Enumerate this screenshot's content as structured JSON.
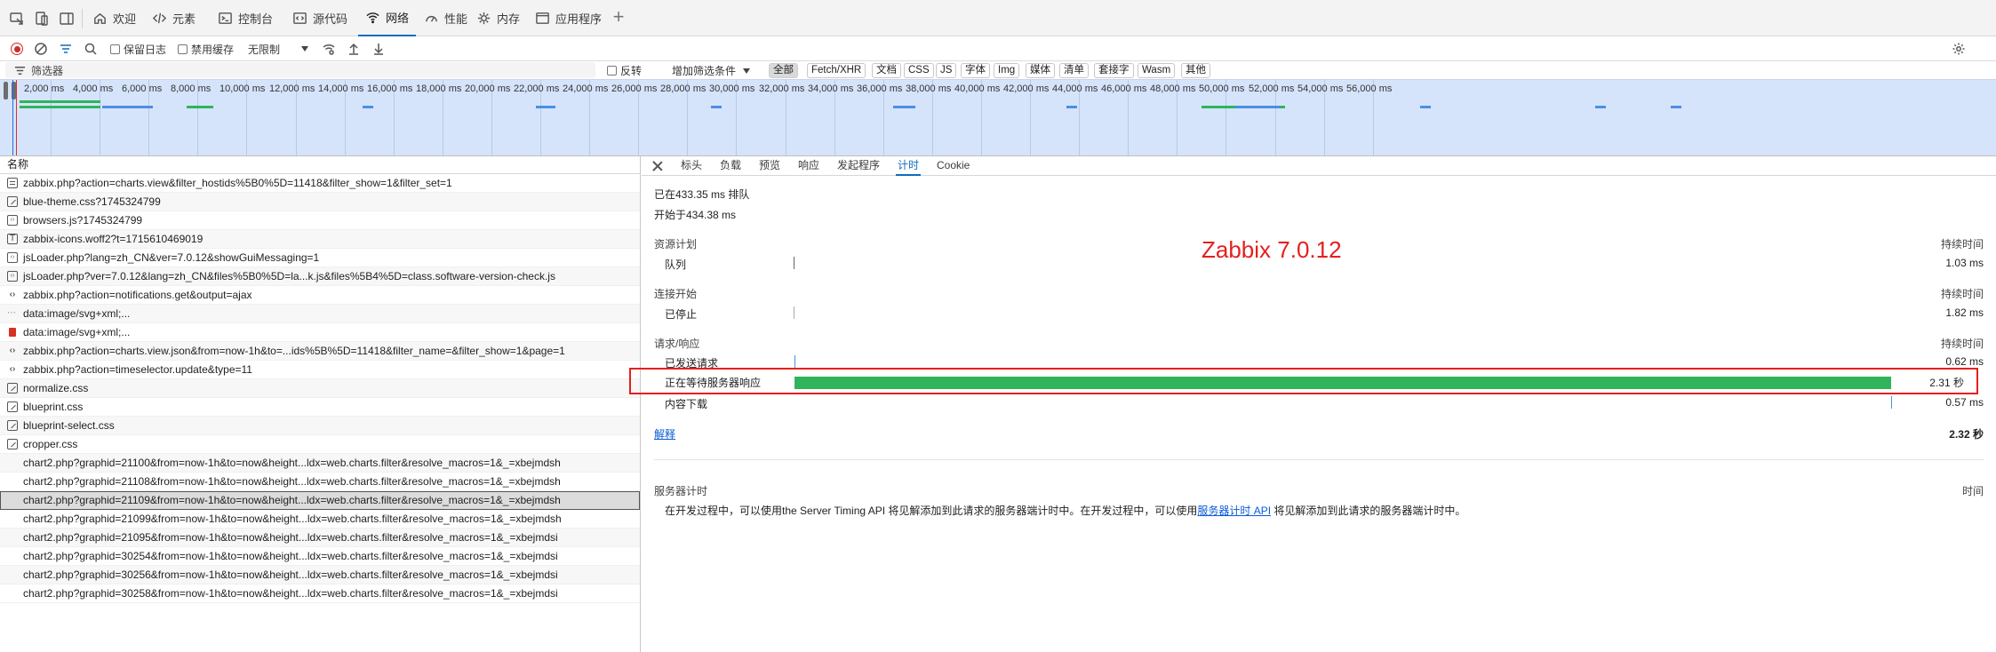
{
  "tabbar": {
    "tabs": [
      {
        "label": "欢迎",
        "icon": "home-icon"
      },
      {
        "label": "元素",
        "icon": "code-icon"
      },
      {
        "label": "控制台",
        "icon": "console-icon"
      },
      {
        "label": "源代码",
        "icon": "sources-icon"
      },
      {
        "label": "网络",
        "icon": "wifi-icon"
      },
      {
        "label": "性能",
        "icon": "performance-icon"
      },
      {
        "label": "内存",
        "icon": "memory-icon"
      },
      {
        "label": "应用程序",
        "icon": "application-icon"
      }
    ],
    "active_tab": "网络"
  },
  "toolbar": {
    "preserve_log": "保留日志",
    "disable_cache": "禁用缓存",
    "throttling": "无限制"
  },
  "filter": {
    "placeholder": "筛选器",
    "invert": "反转",
    "more_filters": "增加筛选条件",
    "types": [
      "全部",
      "Fetch/XHR",
      "文档",
      "CSS",
      "JS",
      "字体",
      "Img",
      "媒体",
      "清单",
      "套接字",
      "Wasm",
      "其他"
    ],
    "active_type": "全部"
  },
  "overview": {
    "ticks": [
      "2,000 ms",
      "4,000 ms",
      "6,000 ms",
      "8,000 ms",
      "10,000 ms",
      "12,000 ms",
      "14,000 ms",
      "16,000 ms",
      "18,000 ms",
      "20,000 ms",
      "22,000 ms",
      "24,000 ms",
      "26,000 ms",
      "28,000 ms",
      "30,000 ms",
      "32,000 ms",
      "34,000 ms",
      "36,000 ms",
      "38,000 ms",
      "40,000 ms",
      "42,000 ms",
      "44,000 ms",
      "46,000 ms",
      "48,000 ms",
      "50,000 ms",
      "52,000 ms",
      "54,000 ms",
      "56,000 ms"
    ],
    "colors": {
      "waiting": "#2fb45c",
      "receiving": "#4a90e2",
      "background": "#d5e4fb"
    }
  },
  "requests": {
    "header": "名称",
    "rows": [
      {
        "name": "zabbix.php?action=charts.view&filter_hostids%5B0%5D=11418&filter_show=1&filter_set=1",
        "icon": "document-icon"
      },
      {
        "name": "blue-theme.css?1745324799",
        "icon": "stylesheet-icon"
      },
      {
        "name": "browsers.js?1745324799",
        "icon": "script-icon"
      },
      {
        "name": "zabbix-icons.woff2?t=1715610469019",
        "icon": "font-icon"
      },
      {
        "name": "jsLoader.php?lang=zh_CN&ver=7.0.12&showGuiMessaging=1",
        "icon": "script-icon"
      },
      {
        "name": "jsLoader.php?ver=7.0.12&lang=zh_CN&files%5B0%5D=la...k.js&files%5B4%5D=class.software-version-check.js",
        "icon": "script-icon"
      },
      {
        "name": "zabbix.php?action=notifications.get&output=ajax",
        "icon": "fetch-icon"
      },
      {
        "name": "data:image/svg+xml;...",
        "icon": "svg-data-icon"
      },
      {
        "name": "data:image/svg+xml;...",
        "icon": "image-icon"
      },
      {
        "name": "zabbix.php?action=charts.view.json&from=now-1h&to=...ids%5B%5D=11418&filter_name=&filter_show=1&page=1",
        "icon": "fetch-icon"
      },
      {
        "name": "zabbix.php?action=timeselector.update&type=11",
        "icon": "fetch-icon"
      },
      {
        "name": "normalize.css",
        "icon": "stylesheet-icon"
      },
      {
        "name": "blueprint.css",
        "icon": "stylesheet-icon"
      },
      {
        "name": "blueprint-select.css",
        "icon": "stylesheet-icon"
      },
      {
        "name": "cropper.css",
        "icon": "stylesheet-icon"
      },
      {
        "name": "chart2.php?graphid=21100&from=now-1h&to=now&height...ldx=web.charts.filter&resolve_macros=1&_=xbejmdsh",
        "icon": ""
      },
      {
        "name": "chart2.php?graphid=21108&from=now-1h&to=now&height...ldx=web.charts.filter&resolve_macros=1&_=xbejmdsh",
        "icon": ""
      },
      {
        "name": "chart2.php?graphid=21109&from=now-1h&to=now&height...ldx=web.charts.filter&resolve_macros=1&_=xbejmdsh",
        "icon": ""
      },
      {
        "name": "chart2.php?graphid=21099&from=now-1h&to=now&height...ldx=web.charts.filter&resolve_macros=1&_=xbejmdsh",
        "icon": ""
      },
      {
        "name": "chart2.php?graphid=21095&from=now-1h&to=now&height...ldx=web.charts.filter&resolve_macros=1&_=xbejmdsi",
        "icon": ""
      },
      {
        "name": "chart2.php?graphid=30254&from=now-1h&to=now&height...ldx=web.charts.filter&resolve_macros=1&_=xbejmdsi",
        "icon": ""
      },
      {
        "name": "chart2.php?graphid=30256&from=now-1h&to=now&height...ldx=web.charts.filter&resolve_macros=1&_=xbejmdsi",
        "icon": ""
      },
      {
        "name": "chart2.php?graphid=30258&from=now-1h&to=now&height...ldx=web.charts.filter&resolve_macros=1&_=xbejmdsi",
        "icon": ""
      }
    ],
    "selected_index": 17
  },
  "detail": {
    "tabs": [
      "标头",
      "负载",
      "预览",
      "响应",
      "发起程序",
      "计时",
      "Cookie"
    ],
    "active_tab": "计时",
    "queued_at": "已在433.35 ms 排队",
    "started_at": "开始于434.38 ms",
    "duration_header": "持续时间",
    "sections": {
      "resource_scheduling": {
        "title": "资源计划",
        "label": "队列",
        "duration": "1.03 ms"
      },
      "connection_start": {
        "title": "连接开始",
        "label": "已停止",
        "duration": "1.82 ms"
      },
      "request_response": {
        "title": "请求/响应",
        "sent": {
          "label": "已发送请求",
          "duration": "0.62 ms"
        },
        "waiting": {
          "label": "正在等待服务器响应",
          "duration": "2.31 秒"
        },
        "download": {
          "label": "内容下载",
          "duration": "0.57 ms"
        }
      }
    },
    "explanation_link": "解释",
    "total": "2.32 秒",
    "server_timing": {
      "title": "服务器计时",
      "time_header": "时间",
      "text_prefix": "在开发过程中，可以使用the Server Timing API 将见解添加到此请求的服务器端计时中。在开发过程中，可以使用",
      "link": "服务器计时 API",
      "text_suffix": " 将见解添加到此请求的服务器端计时中。"
    },
    "annotation": "Zabbix 7.0.12"
  },
  "edge": {
    "cut_text": "控"
  }
}
